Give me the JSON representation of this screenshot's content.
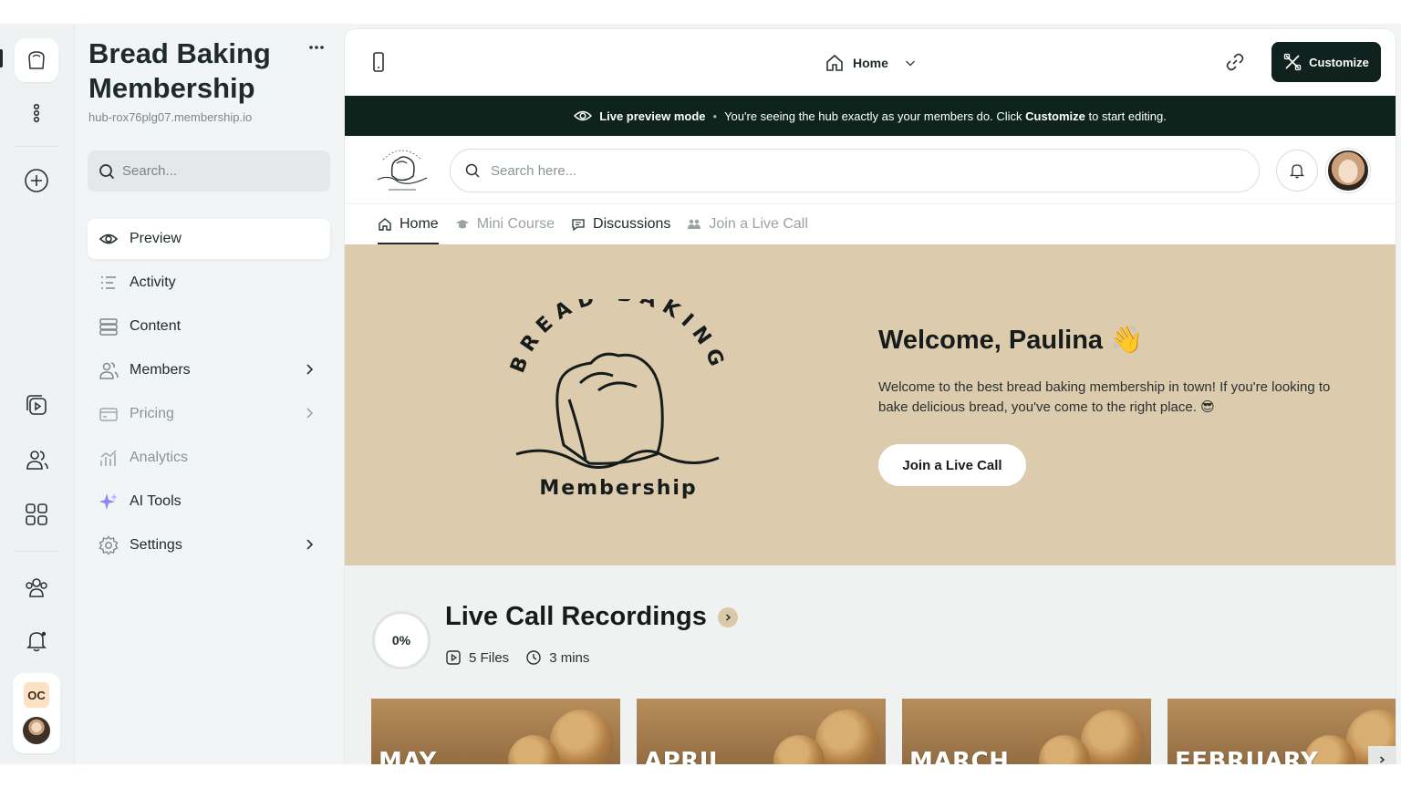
{
  "sidebar": {
    "hub_title": "Bread Baking Membership",
    "hub_url": "hub-rox76plg07.membership.io",
    "search_placeholder": "Search...",
    "items": [
      {
        "label": "Preview",
        "icon": "eye-icon"
      },
      {
        "label": "Activity",
        "icon": "activity-icon"
      },
      {
        "label": "Content",
        "icon": "content-icon"
      },
      {
        "label": "Members",
        "icon": "members-icon"
      },
      {
        "label": "Pricing",
        "icon": "pricing-icon"
      },
      {
        "label": "Analytics",
        "icon": "analytics-icon"
      },
      {
        "label": "AI Tools",
        "icon": "sparkle-icon"
      },
      {
        "label": "Settings",
        "icon": "gear-icon"
      }
    ]
  },
  "rail": {
    "user_initials": "OC"
  },
  "topbar": {
    "page_selector": "Home",
    "customize_label": "Customize"
  },
  "banner": {
    "mode_label": "Live preview mode",
    "separator": "•",
    "message_prefix": "You're seeing the hub exactly as your members do. Click",
    "message_bold": "Customize",
    "message_suffix": "to start editing."
  },
  "hub": {
    "search_placeholder": "Search here...",
    "tabs": [
      {
        "label": "Home"
      },
      {
        "label": "Mini Course"
      },
      {
        "label": "Discussions"
      },
      {
        "label": "Join a Live Call"
      }
    ]
  },
  "hero": {
    "welcome": "Welcome, Paulina",
    "wave_emoji": "👋",
    "description": "Welcome to the best bread baking membership in town! If you're looking to bake delicious bread, you've come to the right place. 😎",
    "cta": "Join a Live Call",
    "logo_arc_text": "BREAD BAKING",
    "logo_word": "Membership"
  },
  "section": {
    "progress": "0%",
    "progress_value": 0,
    "title": "Live Call Recordings",
    "files": "5 Files",
    "duration": "3 mins",
    "cards": [
      "MAY",
      "APRIL",
      "MARCH",
      "FEBRUARY"
    ]
  },
  "colors": {
    "dark_green": "#0e231c",
    "hero_bg": "#dccbad",
    "accent_bg": "#f2f5f5"
  }
}
